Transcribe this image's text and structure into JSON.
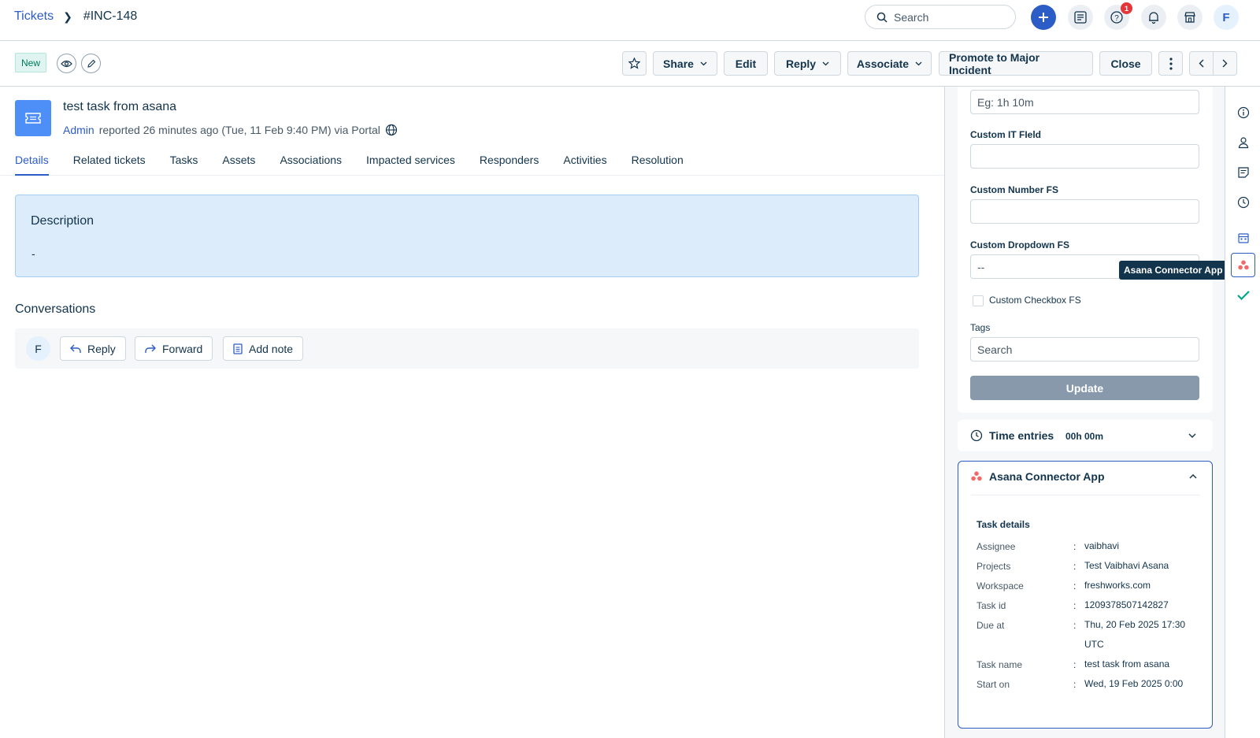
{
  "breadcrumb": {
    "root": "Tickets",
    "current": "#INC-148"
  },
  "header": {
    "search_placeholder": "Search",
    "help_badge": "1",
    "avatar_initial": "F"
  },
  "actions": {
    "status": "New",
    "share": "Share",
    "edit": "Edit",
    "reply": "Reply",
    "associate": "Associate",
    "promote": "Promote to Major Incident",
    "close": "Close"
  },
  "ticket": {
    "title": "test task from asana",
    "reporter": "Admin",
    "meta": "reported 26 minutes ago (Tue, 11 Feb 9:40 PM) via Portal"
  },
  "tabs": [
    "Details",
    "Related tickets",
    "Tasks",
    "Assets",
    "Associations",
    "Impacted services",
    "Responders",
    "Activities",
    "Resolution"
  ],
  "description": {
    "title": "Description",
    "body": "-"
  },
  "conversations": {
    "title": "Conversations",
    "avatar": "F",
    "reply": "Reply",
    "forward": "Forward",
    "add_note": "Add note"
  },
  "properties": {
    "time_placeholder": "Eg: 1h 10m",
    "custom_it_field": "Custom IT FIeld",
    "custom_number": "Custom Number FS",
    "custom_dropdown": "Custom Dropdown FS",
    "dropdown_value": "--",
    "custom_checkbox": "Custom Checkbox FS",
    "tags": "Tags",
    "tags_placeholder": "Search",
    "update": "Update"
  },
  "time_entries": {
    "label": "Time entries",
    "value": "00h 00m"
  },
  "asana": {
    "title": "Asana Connector App",
    "tooltip": "Asana Connector App",
    "section": "Task details",
    "rows": [
      {
        "key": "Assignee",
        "value": "vaibhavi"
      },
      {
        "key": "Projects",
        "value": "Test Vaibhavi Asana"
      },
      {
        "key": "Workspace",
        "value": "freshworks.com"
      },
      {
        "key": "Task id",
        "value": "1209378507142827"
      },
      {
        "key": "Due at",
        "value": "Thu, 20 Feb 2025 17:30 UTC"
      },
      {
        "key": "Task name",
        "value": "test task from asana"
      },
      {
        "key": "Start on",
        "value": "Wed, 19 Feb 2025 0:00"
      }
    ],
    "colon": ":"
  },
  "colors": {
    "primary": "#2c5cc5",
    "asana": "#f06a6a",
    "description_bg": "#dcecfb"
  }
}
